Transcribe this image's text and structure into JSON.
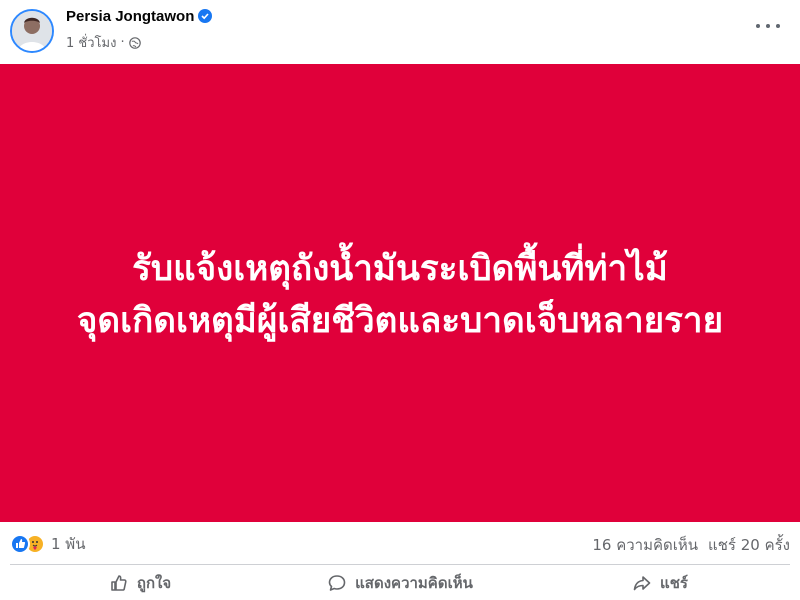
{
  "post": {
    "author": "Persia Jongtawon",
    "timestamp": "1 ชั่วโมง",
    "privacy_icon": "globe-icon",
    "image_text_line1": "รับแจ้งเหตุถังน้ำมันระเบิดพื้นที่ท่าไม้",
    "image_text_line2": "จุดเกิดเหตุมีผู้เสียชีวิตและบาดเจ็บหลายราย",
    "image_background": "#e0003a"
  },
  "stats": {
    "reactions_count": "1 พัน",
    "comments": "16 ความคิดเห็น",
    "shares": "แชร์ 20 ครั้ง"
  },
  "actions": {
    "like": "ถูกใจ",
    "comment": "แสดงความคิดเห็น",
    "share": "แชร์"
  },
  "colors": {
    "accent": "#1877f2",
    "muted_text": "#65676b"
  }
}
